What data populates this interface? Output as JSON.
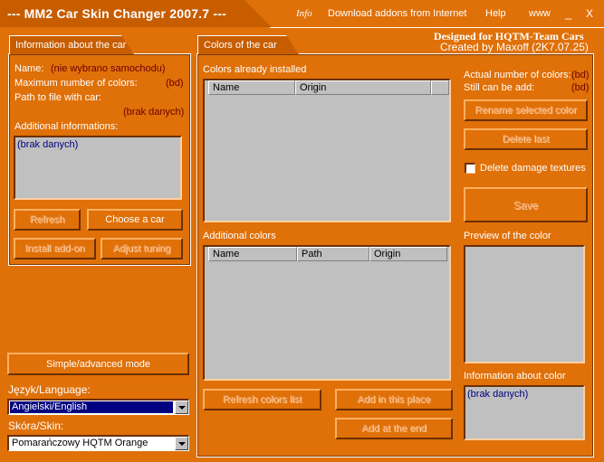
{
  "titlebar": {
    "title": "--- MM2 Car Skin Changer 2007.7 ---",
    "menu": [
      "Info",
      "Download addons from Internet",
      "Help",
      "www"
    ],
    "minimize": "_",
    "close": "X"
  },
  "left_panel": {
    "tab": "Information about the car",
    "name_label": "Name:",
    "name_value": "(nie wybrano samochodu)",
    "max_colors_label": "Maximum number of colors:",
    "max_colors_value": "(bd)",
    "path_label": "Path to file with car:",
    "path_value": "(brak danych)",
    "additional_label": "Additional informations:",
    "additional_value": "(brak danych)",
    "refresh": "Refresh",
    "choose_car": "Choose a car",
    "install_addon": "Install add-on",
    "adjust_tuning": "Adjust tuning"
  },
  "bottom_left": {
    "mode_button": "Simple/advanced mode",
    "language_label": "Język/Language:",
    "language_value": "Angielski/English",
    "skin_label": "Skóra/Skin:",
    "skin_value": "Pomarańczowy HQTM Orange"
  },
  "right_panel": {
    "tab": "Colors of the car",
    "designed_for": "Designed for HQTM-Team Cars",
    "created_by": "Created by Maxoff (2K7.07.25)",
    "installed_label": "Colors already installed",
    "installed_columns": [
      "Name",
      "Origin"
    ],
    "additional_label": "Additional colors",
    "additional_columns": [
      "Name",
      "Path",
      "Origin"
    ],
    "actual_colors_label": "Actual number of colors:",
    "actual_colors_value": "(bd)",
    "still_can_add_label": "Still can be add:",
    "still_can_add_value": "(bd)",
    "rename_button": "Rename selected color",
    "delete_last_button": "Delete last",
    "delete_damage_label": "Delete damage textures",
    "save_button": "Save",
    "preview_label": "Preview of the color",
    "info_label": "Information about color",
    "info_value": "(brak danych)",
    "refresh_list_button": "Refresh colors list",
    "add_place_button": "Add in this place",
    "add_end_button": "Add at the end"
  },
  "colors": {
    "background": "#e07008",
    "tab": "#c85d00",
    "list_bg": "#c0c0c0",
    "value_text": "#6b0000",
    "selection": "#000080"
  }
}
